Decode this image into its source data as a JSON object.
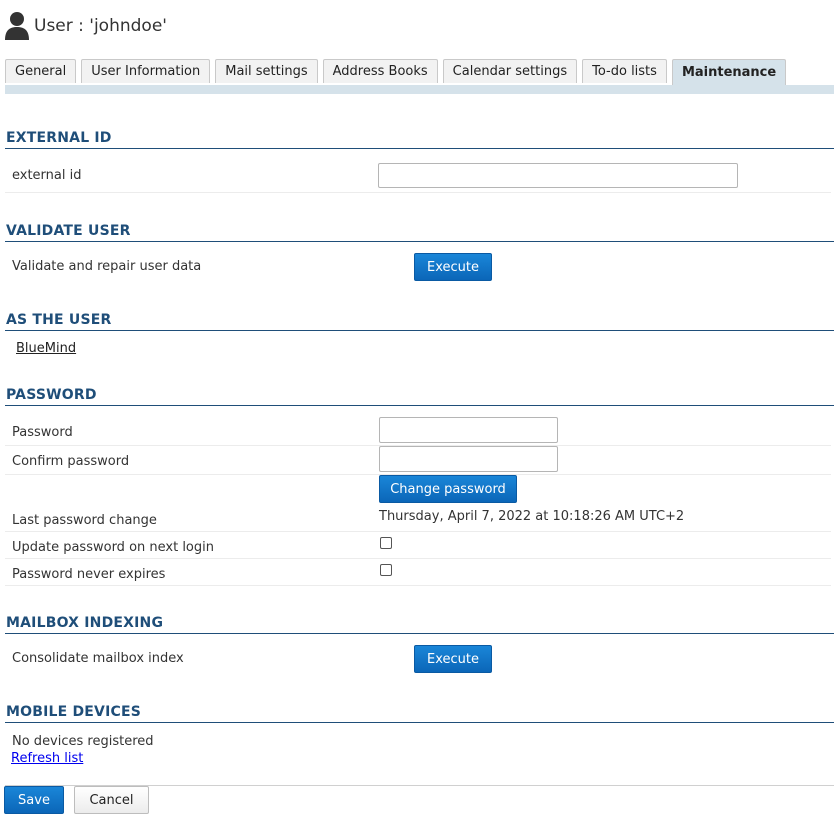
{
  "header": {
    "title": "User : 'johndoe'",
    "icon": "user-icon"
  },
  "tabs": [
    {
      "label": "General"
    },
    {
      "label": "User Information"
    },
    {
      "label": "Mail settings"
    },
    {
      "label": "Address Books"
    },
    {
      "label": "Calendar settings"
    },
    {
      "label": "To-do lists"
    },
    {
      "label": "Maintenance",
      "active": true
    }
  ],
  "sections": {
    "external_id": {
      "title": "EXTERNAL ID",
      "label": "external id",
      "value": ""
    },
    "validate_user": {
      "title": "VALIDATE USER",
      "label": "Validate and repair user data",
      "button": "Execute"
    },
    "as_the_user": {
      "title": "AS THE USER",
      "link": "BlueMind"
    },
    "password": {
      "title": "PASSWORD",
      "password_label": "Password",
      "password_value": "",
      "confirm_label": "Confirm password",
      "confirm_value": "",
      "change_button": "Change password",
      "last_change_label": "Last password change",
      "last_change_value": "Thursday, April 7, 2022 at 10:18:26 AM UTC+2",
      "update_next_login_label": "Update password on next login",
      "update_next_login_checked": false,
      "never_expires_label": "Password never expires",
      "never_expires_checked": false
    },
    "mailbox_indexing": {
      "title": "MAILBOX INDEXING",
      "label": "Consolidate mailbox index",
      "button": "Execute"
    },
    "mobile_devices": {
      "title": "MOBILE DEVICES",
      "status": "No devices registered",
      "refresh_link": "Refresh list"
    }
  },
  "footer": {
    "save_label": "Save",
    "cancel_label": "Cancel"
  },
  "colors": {
    "accent": "#1f4e79",
    "primary_button": "#0b66b8",
    "tab_active": "#d5e2ea"
  }
}
